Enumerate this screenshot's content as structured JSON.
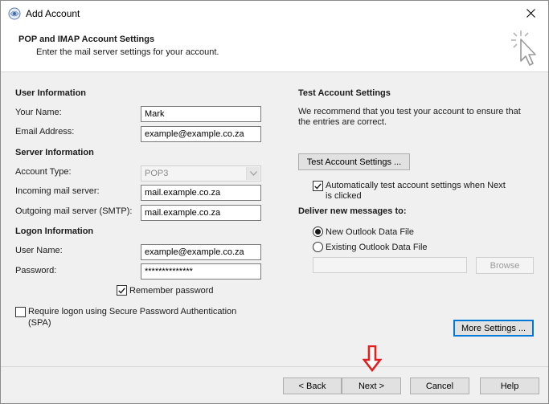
{
  "window": {
    "title": "Add Account"
  },
  "header": {
    "title": "POP and IMAP Account Settings",
    "subtitle": "Enter the mail server settings for your account."
  },
  "user_info": {
    "heading": "User Information",
    "your_name_label": "Your Name:",
    "your_name_value": "Mark",
    "email_label": "Email Address:",
    "email_value": "example@example.co.za"
  },
  "server_info": {
    "heading": "Server Information",
    "account_type_label": "Account Type:",
    "account_type_value": "POP3",
    "incoming_label": "Incoming mail server:",
    "incoming_value": "mail.example.co.za",
    "outgoing_label": "Outgoing mail server (SMTP):",
    "outgoing_value": "mail.example.co.za"
  },
  "logon_info": {
    "heading": "Logon Information",
    "user_name_label": "User Name:",
    "user_name_value": "example@example.co.za",
    "password_label": "Password:",
    "password_value": "**************",
    "remember_label": "Remember password",
    "remember_checked": true,
    "spa_label_line1": "Require logon using Secure Password Authentication",
    "spa_label_line2": "(SPA)",
    "spa_checked": false
  },
  "test_settings": {
    "heading": "Test Account Settings",
    "description_line1": "We recommend that you test your account to ensure that",
    "description_line2": "the entries are correct.",
    "test_button": "Test Account Settings ...",
    "auto_test_line1": "Automatically test account settings when Next",
    "auto_test_line2": "is clicked",
    "auto_test_checked": true
  },
  "deliver": {
    "heading": "Deliver new messages to:",
    "option_new": "New Outlook Data File",
    "option_existing": "Existing Outlook Data File",
    "selected": "new",
    "browse_button": "Browse"
  },
  "more_settings_button": "More Settings ...",
  "footer": {
    "back": "< Back",
    "next": "Next >",
    "cancel": "Cancel",
    "help": "Help"
  },
  "colors": {
    "accent": "#0078d7",
    "arrow": "#e02020"
  }
}
